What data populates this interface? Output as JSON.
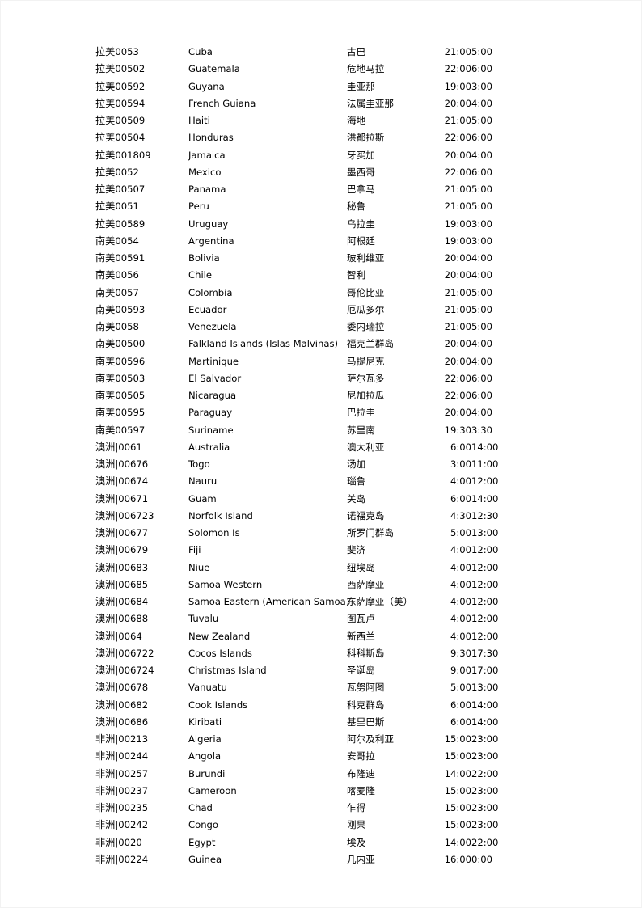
{
  "document": {
    "type": "timezone-table",
    "columns": [
      "region_code",
      "country_en",
      "country_zh",
      "time_a",
      "time_b"
    ],
    "rows": [
      {
        "region": "拉美",
        "sep": "",
        "code": "0053",
        "en": "Cuba",
        "zh": "古巴",
        "t1": "21:00",
        "t2": "5:00"
      },
      {
        "region": "拉美",
        "sep": "",
        "code": "00502",
        "en": "Guatemala",
        "zh": "危地马拉",
        "t1": "22:00",
        "t2": "6:00"
      },
      {
        "region": "拉美",
        "sep": "",
        "code": "00592",
        "en": "Guyana",
        "zh": "圭亚那",
        "t1": "19:00",
        "t2": "3:00"
      },
      {
        "region": "拉美",
        "sep": "",
        "code": "00594",
        "en": "French Guiana",
        "zh": "法属圭亚那",
        "t1": "20:00",
        "t2": "4:00"
      },
      {
        "region": "拉美",
        "sep": "",
        "code": "00509",
        "en": "Haiti",
        "zh": "海地",
        "t1": "21:00",
        "t2": "5:00"
      },
      {
        "region": "拉美",
        "sep": "",
        "code": "00504",
        "en": "Honduras",
        "zh": "洪都拉斯",
        "t1": "22:00",
        "t2": "6:00"
      },
      {
        "region": "拉美",
        "sep": "",
        "code": "001809",
        "en": "Jamaica",
        "zh": "牙买加",
        "t1": "20:00",
        "t2": "4:00"
      },
      {
        "region": "拉美",
        "sep": "",
        "code": "0052",
        "en": "Mexico",
        "zh": "墨西哥",
        "t1": "22:00",
        "t2": "6:00"
      },
      {
        "region": "拉美",
        "sep": "",
        "code": "00507",
        "en": "Panama",
        "zh": "巴拿马",
        "t1": "21:00",
        "t2": "5:00"
      },
      {
        "region": "拉美",
        "sep": "",
        "code": "0051",
        "en": "Peru",
        "zh": "秘鲁",
        "t1": "21:00",
        "t2": "5:00"
      },
      {
        "region": "拉美",
        "sep": "",
        "code": "00589",
        "en": "Uruguay",
        "zh": "乌拉圭",
        "t1": "19:00",
        "t2": "3:00"
      },
      {
        "region": "南美",
        "sep": "",
        "code": "0054",
        "en": "Argentina",
        "zh": "阿根廷",
        "t1": "19:00",
        "t2": "3:00"
      },
      {
        "region": "南美",
        "sep": "",
        "code": "00591",
        "en": "Bolivia",
        "zh": "玻利维亚",
        "t1": "20:00",
        "t2": "4:00"
      },
      {
        "region": "南美",
        "sep": "",
        "code": "0056",
        "en": "Chile",
        "zh": "智利",
        "t1": "20:00",
        "t2": "4:00"
      },
      {
        "region": "南美",
        "sep": "",
        "code": "0057",
        "en": "Colombia",
        "zh": "哥伦比亚",
        "t1": "21:00",
        "t2": "5:00"
      },
      {
        "region": "南美",
        "sep": "",
        "code": "00593",
        "en": "Ecuador",
        "zh": "厄瓜多尔",
        "t1": "21:00",
        "t2": "5:00"
      },
      {
        "region": "南美",
        "sep": "",
        "code": "0058",
        "en": "Venezuela",
        "zh": "委内瑞拉",
        "t1": "21:00",
        "t2": "5:00"
      },
      {
        "region": "南美",
        "sep": "",
        "code": "00500",
        "en": "Falkland Islands (Islas Malvinas)",
        "zh": "福克兰群岛",
        "t1": "20:00",
        "t2": "4:00"
      },
      {
        "region": "南美",
        "sep": "",
        "code": "00596",
        "en": "Martinique",
        "zh": "马提尼克",
        "t1": "20:00",
        "t2": "4:00"
      },
      {
        "region": "南美",
        "sep": "",
        "code": "00503",
        "en": "El Salvador",
        "zh": "萨尔瓦多",
        "t1": "22:00",
        "t2": "6:00"
      },
      {
        "region": "南美",
        "sep": "",
        "code": "00505",
        "en": "Nicaragua",
        "zh": "尼加拉瓜",
        "t1": "22:00",
        "t2": "6:00"
      },
      {
        "region": "南美",
        "sep": "",
        "code": "00595",
        "en": "Paraguay",
        "zh": "巴拉圭",
        "t1": "20:00",
        "t2": "4:00"
      },
      {
        "region": "南美",
        "sep": "",
        "code": "00597",
        "en": "Suriname",
        "zh": "苏里南",
        "t1": "19:30",
        "t2": "3:30"
      },
      {
        "region": "澳洲",
        "sep": "|",
        "code": "0061",
        "en": "Australia",
        "zh": "澳大利亚",
        "t1": "6:00",
        "t2": "14:00"
      },
      {
        "region": "澳洲",
        "sep": "|",
        "code": "00676",
        "en": "Togo",
        "zh": "汤加",
        "t1": "3:00",
        "t2": "11:00"
      },
      {
        "region": "澳洲",
        "sep": "|",
        "code": "00674",
        "en": "Nauru",
        "zh": "瑙鲁",
        "t1": "4:00",
        "t2": "12:00"
      },
      {
        "region": "澳洲",
        "sep": "|",
        "code": "00671",
        "en": "Guam",
        "zh": "关岛",
        "t1": "6:00",
        "t2": "14:00"
      },
      {
        "region": "澳洲",
        "sep": "|",
        "code": "006723",
        "en": "Norfolk Island",
        "zh": "诺福克岛",
        "t1": "4:30",
        "t2": "12:30"
      },
      {
        "region": "澳洲",
        "sep": "|",
        "code": "00677",
        "en": "Solomon  Is",
        "zh": "所罗门群岛",
        "t1": "5:00",
        "t2": "13:00"
      },
      {
        "region": "澳洲",
        "sep": "|",
        "code": "00679",
        "en": "Fiji",
        "zh": "斐济",
        "t1": "4:00",
        "t2": "12:00"
      },
      {
        "region": "澳洲",
        "sep": "|",
        "code": "00683",
        "en": "Niue",
        "zh": "纽埃岛",
        "t1": "4:00",
        "t2": "12:00"
      },
      {
        "region": "澳洲",
        "sep": "|",
        "code": "00685",
        "en": "Samoa Western",
        "zh": "西萨摩亚",
        "t1": "4:00",
        "t2": "12:00"
      },
      {
        "region": "澳洲",
        "sep": "|",
        "code": "00684",
        "en": "Samoa Eastern (American Samoa)",
        "zh": "东萨摩亚（美）",
        "t1": "4:00",
        "t2": "12:00"
      },
      {
        "region": "澳洲",
        "sep": "|",
        "code": "00688",
        "en": "Tuvalu",
        "zh": "图瓦卢",
        "t1": "4:00",
        "t2": "12:00"
      },
      {
        "region": "澳洲",
        "sep": "|",
        "code": "0064",
        "en": "New Zealand",
        "zh": "新西兰",
        "t1": "4:00",
        "t2": "12:00"
      },
      {
        "region": "澳洲",
        "sep": "|",
        "code": "006722",
        "en": "Cocos Islands",
        "zh": "科科斯岛",
        "t1": "9:30",
        "t2": "17:30"
      },
      {
        "region": "澳洲",
        "sep": "|",
        "code": "006724",
        "en": "Christmas Island",
        "zh": "圣诞岛",
        "t1": "9:00",
        "t2": "17:00"
      },
      {
        "region": "澳洲",
        "sep": "|",
        "code": "00678",
        "en": "Vanuatu",
        "zh": "瓦努阿图",
        "t1": "5:00",
        "t2": "13:00"
      },
      {
        "region": "澳洲",
        "sep": "|",
        "code": "00682",
        "en": "Cook Islands",
        "zh": "科克群岛",
        "t1": "6:00",
        "t2": "14:00"
      },
      {
        "region": "澳洲",
        "sep": "|",
        "code": "00686",
        "en": "Kiribati",
        "zh": "基里巴斯",
        "t1": "6:00",
        "t2": "14:00"
      },
      {
        "region": "非洲",
        "sep": "|",
        "code": "00213",
        "en": "Algeria",
        "zh": "阿尔及利亚",
        "t1": "15:00",
        "t2": "23:00"
      },
      {
        "region": "非洲",
        "sep": "|",
        "code": "00244",
        "en": "Angola",
        "zh": "安哥拉",
        "t1": "15:00",
        "t2": "23:00"
      },
      {
        "region": "非洲",
        "sep": "|",
        "code": "00257",
        "en": "Burundi",
        "zh": "布隆迪",
        "t1": "14:00",
        "t2": "22:00"
      },
      {
        "region": "非洲",
        "sep": "|",
        "code": "00237",
        "en": "Cameroon",
        "zh": "喀麦隆",
        "t1": "15:00",
        "t2": "23:00"
      },
      {
        "region": "非洲",
        "sep": "|",
        "code": "00235",
        "en": "Chad",
        "zh": "乍得",
        "t1": "15:00",
        "t2": "23:00"
      },
      {
        "region": "非洲",
        "sep": "|",
        "code": "00242",
        "en": "Congo",
        "zh": "刚果",
        "t1": "15:00",
        "t2": "23:00"
      },
      {
        "region": "非洲",
        "sep": "|",
        "code": "0020",
        "en": "Egypt",
        "zh": "埃及",
        "t1": "14:00",
        "t2": "22:00"
      },
      {
        "region": "非洲",
        "sep": "|",
        "code": "00224",
        "en": "Guinea",
        "zh": "几内亚",
        "t1": "16:00",
        "t2": "0:00"
      }
    ]
  }
}
